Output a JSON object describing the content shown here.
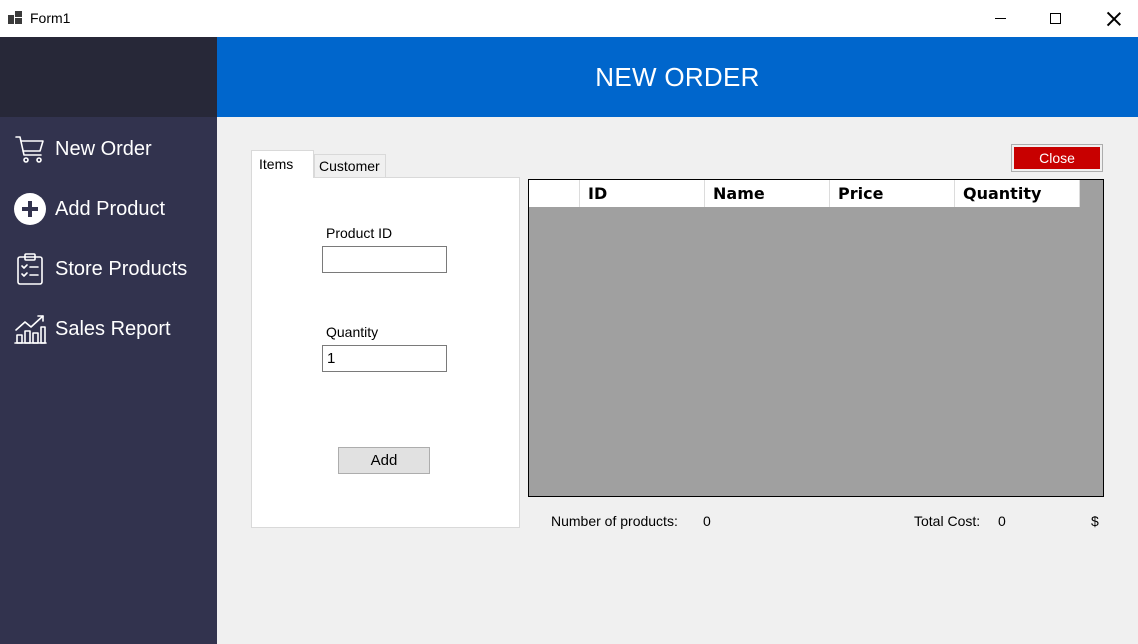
{
  "window": {
    "title": "Form1",
    "controls": [
      "minimize",
      "maximize",
      "close"
    ]
  },
  "sidebar": {
    "items": [
      {
        "label": "New Order",
        "icon": "cart-icon"
      },
      {
        "label": "Add Product",
        "icon": "plus-circle-icon"
      },
      {
        "label": "Store Products",
        "icon": "clipboard-checklist-icon"
      },
      {
        "label": "Sales Report",
        "icon": "chart-trend-icon"
      }
    ]
  },
  "header": {
    "title": "NEW ORDER"
  },
  "tabs": [
    {
      "label": "Items",
      "active": true
    },
    {
      "label": "Customer",
      "active": false
    }
  ],
  "items_form": {
    "product_id_label": "Product ID",
    "product_id_value": "",
    "quantity_label": "Quantity",
    "quantity_value": "1",
    "add_label": "Add"
  },
  "close_button": {
    "label": "Close"
  },
  "grid": {
    "columns": [
      "ID",
      "Name",
      "Price",
      "Quantity"
    ],
    "rows": []
  },
  "summary": {
    "count_label": "Number of products:",
    "count_value": "0",
    "total_label": "Total Cost:",
    "total_value": "0",
    "currency": "$"
  },
  "colors": {
    "header_bg": "#0066cc",
    "sidebar_bg": "#32334e",
    "sidebar_top_bg": "#272838",
    "close_button_bg": "#c80000",
    "grid_bg": "#a0a0a0",
    "main_bg": "#f0f0f0"
  }
}
